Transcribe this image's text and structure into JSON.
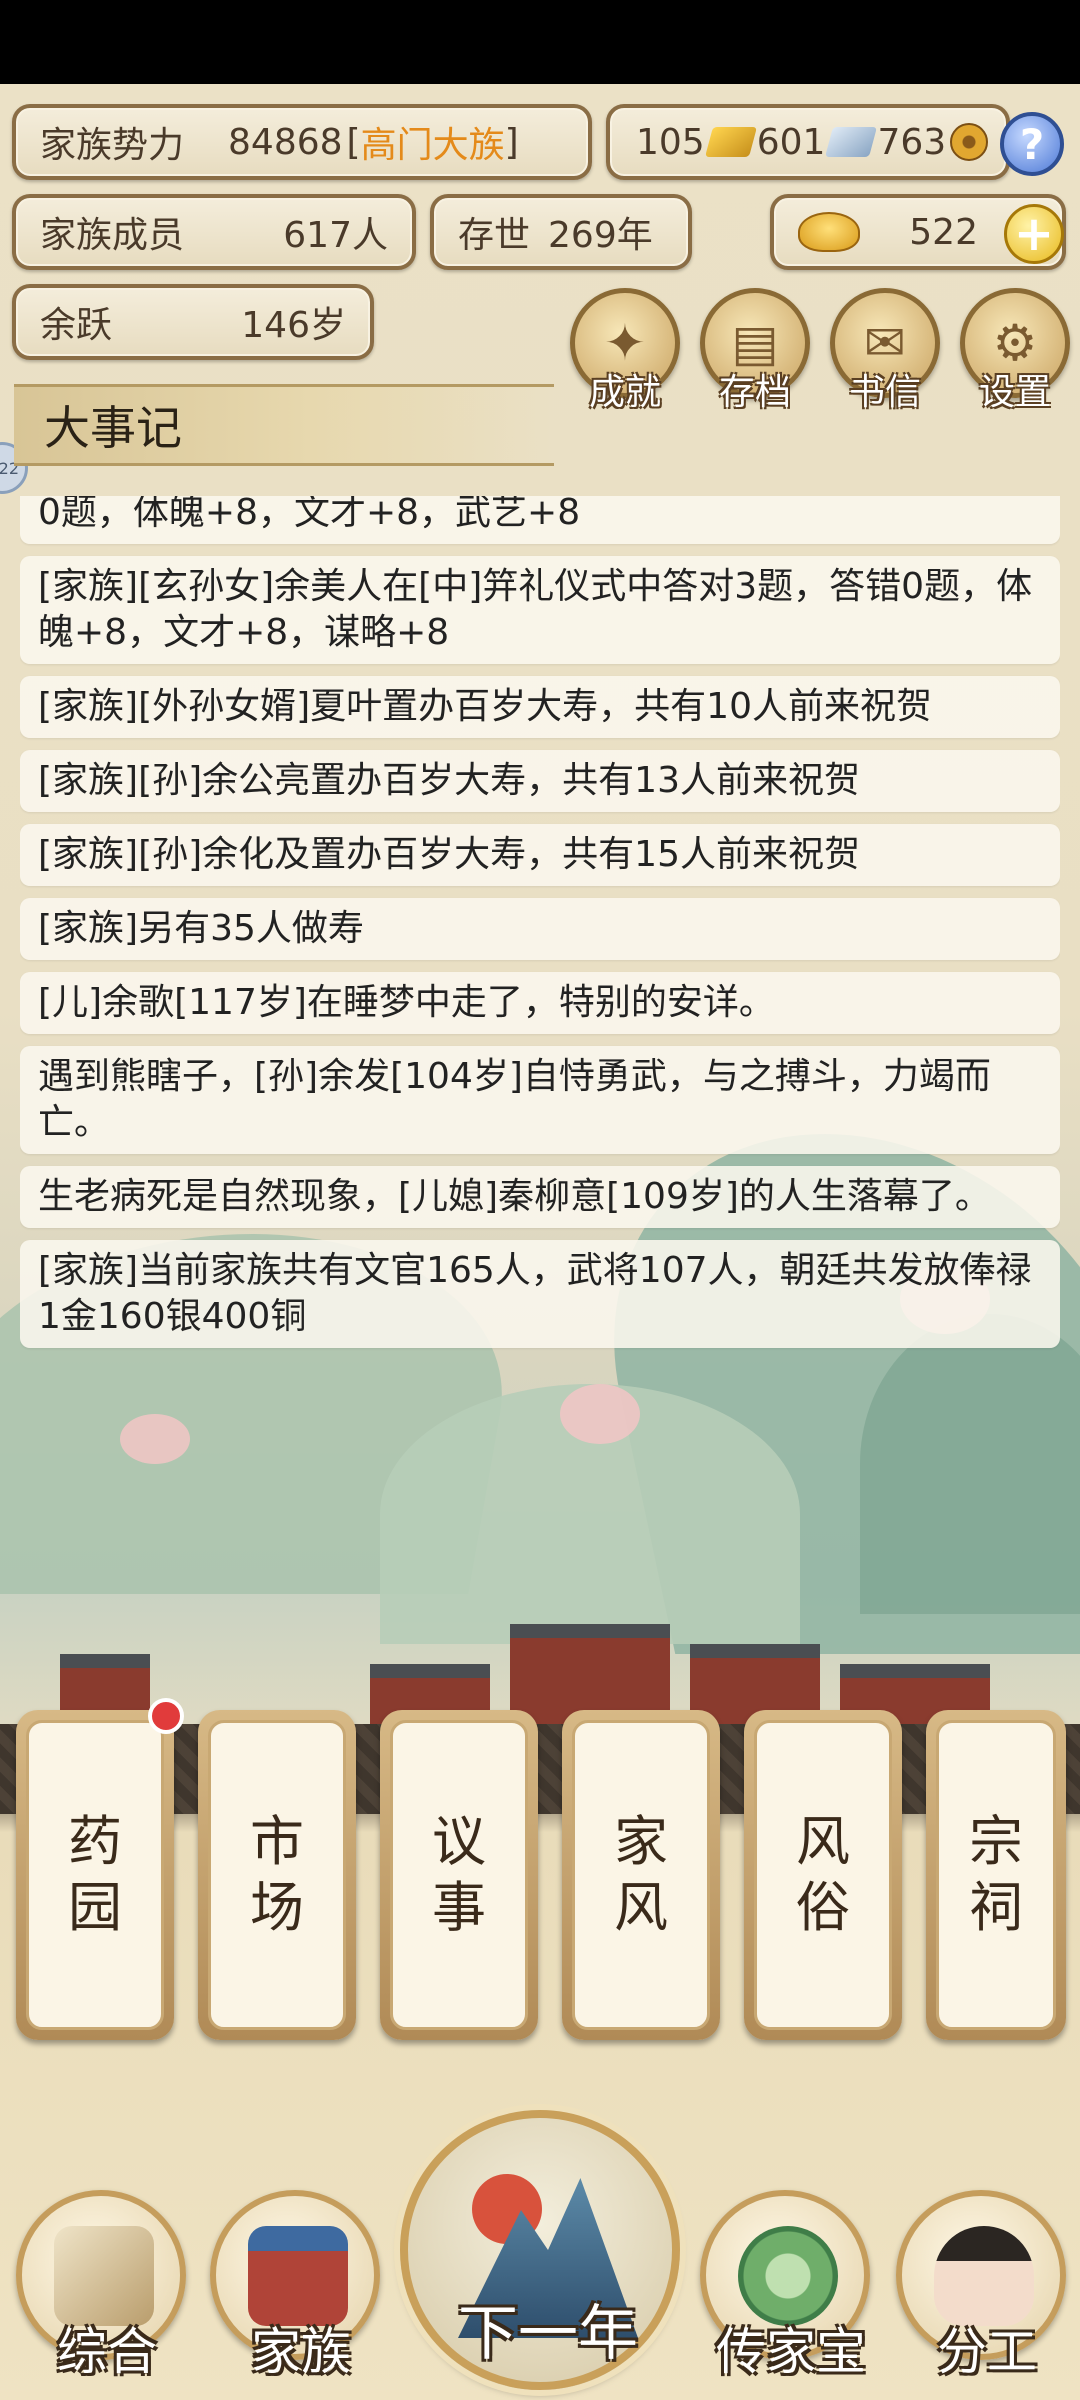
{
  "hud": {
    "power_label": "家族势力",
    "power_value": "84868",
    "power_rank_open": "[",
    "power_rank": "高门大族",
    "power_rank_close": "]",
    "gold_bars": "105",
    "silver": "601",
    "coins": "763",
    "members_label": "家族成员",
    "members_value": "617人",
    "years_label": "存世",
    "years_value": "269年",
    "ingots": "522",
    "head_name": "余跃",
    "head_age": "146岁"
  },
  "menu_buttons": [
    {
      "label": "成就",
      "icon": "trophy-icon"
    },
    {
      "label": "存档",
      "icon": "save-icon"
    },
    {
      "label": "书信",
      "icon": "letter-icon"
    },
    {
      "label": "设置",
      "icon": "settings-icon"
    }
  ],
  "events": {
    "title": "大事记",
    "side_tab": "22",
    "items": [
      "0题，体魄+8，文才+8，武艺+8",
      "[家族][玄孙女]余美人在[中]笄礼仪式中答对3题，答错0题，体魄+8，文才+8，谋略+8",
      "[家族][外孙女婿]夏叶置办百岁大寿，共有10人前来祝贺",
      "[家族][孙]余公亮置办百岁大寿，共有13人前来祝贺",
      "[家族][孙]余化及置办百岁大寿，共有15人前来祝贺",
      "[家族]另有35人做寿",
      "[儿]余歌[117岁]在睡梦中走了，特别的安详。",
      "遇到熊瞎子，[孙]余发[104岁]自恃勇武，与之搏斗，力竭而亡。",
      "生老病死是自然现象，[儿媳]秦柳意[109岁]的人生落幕了。",
      "[家族]当前家族共有文官165人，武将107人，朝廷共发放俸禄1金160银400铜"
    ]
  },
  "cards": [
    {
      "l1": "药",
      "l2": "园",
      "badge": true
    },
    {
      "l1": "市",
      "l2": "场"
    },
    {
      "l1": "议",
      "l2": "事"
    },
    {
      "l1": "家",
      "l2": "风"
    },
    {
      "l1": "风",
      "l2": "俗"
    },
    {
      "l1": "宗",
      "l2": "祠"
    }
  ],
  "nav": {
    "overview": "综合",
    "family": "家族",
    "next_year": "下一年",
    "heirloom": "传家宝",
    "division": "分工"
  },
  "colors": {
    "rank_accent": "#e48a1a",
    "badge": "#e13b3b"
  }
}
